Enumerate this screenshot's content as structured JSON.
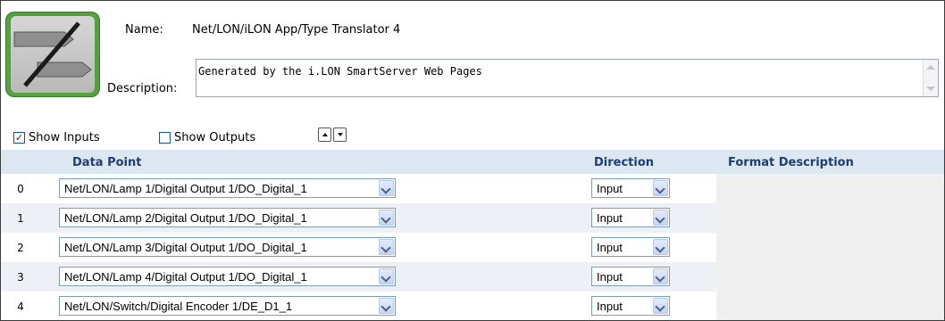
{
  "app": {
    "name_label": "Name:",
    "name_value": "Net/LON/iLON App/Type Translator 4",
    "description_label": "Description:",
    "description_value": "Generated by the i.LON SmartServer Web Pages"
  },
  "toggles": {
    "show_inputs": {
      "label": "Show Inputs",
      "checked": true
    },
    "show_outputs": {
      "label": "Show Outputs",
      "checked": false
    }
  },
  "table": {
    "headers": {
      "data_point": "Data Point",
      "direction": "Direction",
      "format": "Format Description"
    },
    "rows": [
      {
        "index": "0",
        "data_point": "Net/LON/Lamp 1/Digital Output 1/DO_Digital_1",
        "direction": "Input",
        "format": ""
      },
      {
        "index": "1",
        "data_point": "Net/LON/Lamp 2/Digital Output 1/DO_Digital_1",
        "direction": "Input",
        "format": ""
      },
      {
        "index": "2",
        "data_point": "Net/LON/Lamp 3/Digital Output 1/DO_Digital_1",
        "direction": "Input",
        "format": ""
      },
      {
        "index": "3",
        "data_point": "Net/LON/Lamp 4/Digital Output 1/DO_Digital_1",
        "direction": "Input",
        "format": ""
      },
      {
        "index": "4",
        "data_point": "Net/LON/Switch/Digital Encoder 1/DE_D1_1",
        "direction": "Input",
        "format": ""
      }
    ]
  },
  "icons": {
    "logo": "translator-logo-icon",
    "move_up": "move-up-icon",
    "move_down": "move-down-icon",
    "dropdown": "chevron-down-icon"
  },
  "colors": {
    "header_bg": "#dde7f2",
    "header_text": "#1f3e73",
    "logo_green": "#56a040",
    "row_alt": "#edf1f6"
  }
}
